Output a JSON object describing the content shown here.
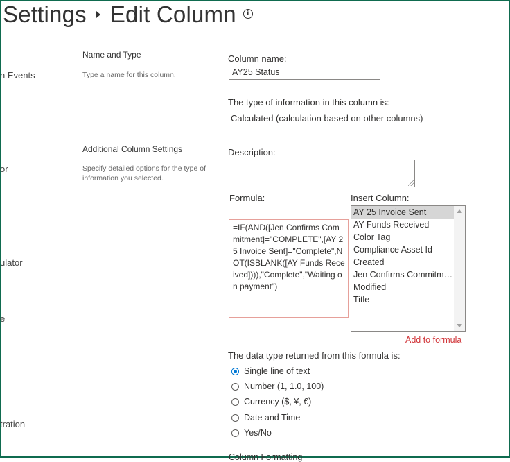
{
  "header": {
    "title_part1": "Settings",
    "title_part2": "Edit Column",
    "info_glyph": "i"
  },
  "leftnav": {
    "items": [
      "n Events",
      "or",
      "ulator",
      "e",
      "tration"
    ]
  },
  "sections": {
    "name_type": {
      "title": "Name and Type",
      "description": "Type a name for this column."
    },
    "additional": {
      "title": "Additional Column Settings",
      "description": "Specify detailed options for the type of information you selected."
    }
  },
  "form": {
    "column_name_label": "Column name:",
    "column_name_value": "AY25 Status",
    "type_info_label": "The type of information in this column is:",
    "type_info_value": "Calculated (calculation based on other columns)",
    "description_label": "Description:",
    "description_value": "",
    "formula_label": "Formula:",
    "formula_value": "=IF(AND([Jen Confirms Commitment]=\"COMPLETE\",[AY 25 Invoice Sent]=\"Complete\",NOT(ISBLANK([AY Funds Received]))),\"Complete\",\"Waiting on payment\")",
    "insert_column_label": "Insert Column:",
    "insert_columns": [
      "AY 25 Invoice Sent",
      "AY Funds Received",
      "Color Tag",
      "Compliance Asset Id",
      "Created",
      "Jen Confirms Commitment",
      "Modified",
      "Title"
    ],
    "selected_insert_column": "AY 25 Invoice Sent",
    "add_to_formula": "Add to formula",
    "return_type_label": "The data type returned from this formula is:",
    "return_types": [
      {
        "label": "Single line of text",
        "checked": true
      },
      {
        "label": "Number (1, 1.0, 100)",
        "checked": false
      },
      {
        "label": "Currency ($, ¥, €)",
        "checked": false
      },
      {
        "label": "Date and Time",
        "checked": false
      },
      {
        "label": "Yes/No",
        "checked": false
      }
    ],
    "column_formatting_label": "Column Formatting"
  },
  "colors": {
    "frame": "#0f6b4f",
    "accent": "#0078d4",
    "link": "#d13438",
    "formula_border": "#e6a09a",
    "list_selected": "#d6d6d6"
  }
}
